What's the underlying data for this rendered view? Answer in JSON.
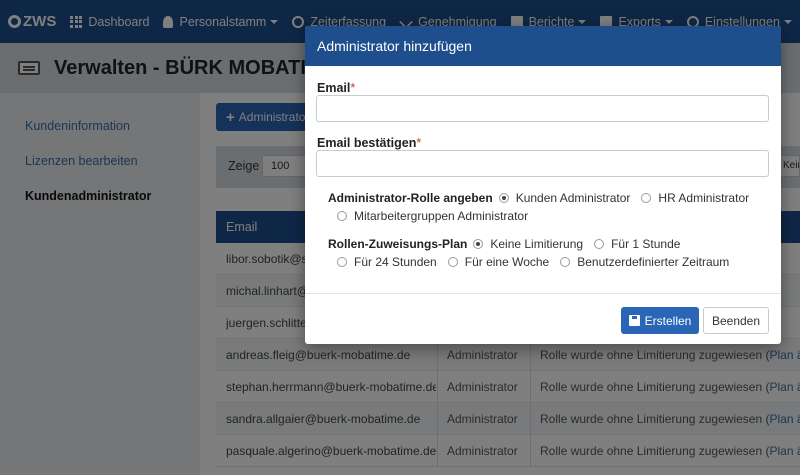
{
  "nav": {
    "logo": "ZWS",
    "items": [
      {
        "label": "Dashboard",
        "icon": "grid-icon",
        "dropdown": false
      },
      {
        "label": "Personalstamm",
        "icon": "user-icon",
        "dropdown": true
      },
      {
        "label": "Zeiterfassung",
        "icon": "clock-icon",
        "dropdown": false
      },
      {
        "label": "Genehmigung",
        "icon": "check-icon",
        "dropdown": false
      },
      {
        "label": "Berichte",
        "icon": "report-icon",
        "dropdown": true
      },
      {
        "label": "Exports",
        "icon": "export-icon",
        "dropdown": true
      },
      {
        "label": "Einstellungen",
        "icon": "gear-icon",
        "dropdown": true
      }
    ]
  },
  "header": {
    "title": "Verwalten - BÜRK MOBATIME G"
  },
  "sidebar": {
    "items": [
      {
        "label": "Kundeninformation",
        "active": false
      },
      {
        "label": "Lizenzen bearbeiten",
        "active": false
      },
      {
        "label": "Kundenadministrator",
        "active": true
      }
    ]
  },
  "main": {
    "add_button": "Administrator",
    "filter": {
      "show_label": "Zeige",
      "per_page": "100",
      "right_value": "Keine"
    },
    "table": {
      "header_email": "Email",
      "rows": [
        {
          "email": "libor.sobotik@se",
          "role": "",
          "plan": "",
          "link": ""
        },
        {
          "email": "michal.linhart@",
          "role": "",
          "plan": "",
          "link": ""
        },
        {
          "email": "juergen.schlitter",
          "role": "",
          "plan": "",
          "link": ""
        },
        {
          "email": "andreas.fleig@buerk-mobatime.de",
          "role": "Administrator",
          "plan": "Rolle wurde ohne Limitierung zugewiesen (",
          "link": "Plan ände"
        },
        {
          "email": "stephan.herrmann@buerk-mobatime.de",
          "role": "Administrator",
          "plan": "Rolle wurde ohne Limitierung zugewiesen (",
          "link": "Plan ände"
        },
        {
          "email": "sandra.allgaier@buerk-mobatime.de",
          "role": "Administrator",
          "plan": "Rolle wurde ohne Limitierung zugewiesen (",
          "link": "Plan ände"
        },
        {
          "email": "pasquale.algerino@buerk-mobatime.de",
          "role": "Administrator",
          "plan": "Rolle wurde ohne Limitierung zugewiesen (",
          "link": "Plan ände"
        }
      ]
    }
  },
  "modal": {
    "title": "Administrator hinzufügen",
    "email_label": "Email",
    "email_value": "",
    "email_confirm_label": "Email bestätigen",
    "email_confirm_value": "",
    "required_mark": "*",
    "role_group_label": "Administrator-Rolle angeben",
    "role_options": [
      {
        "label": "Kunden Administrator",
        "selected": true
      },
      {
        "label": "HR Administrator",
        "selected": false
      },
      {
        "label": "Mitarbeitergruppen Administrator",
        "selected": false
      }
    ],
    "plan_group_label": "Rollen-Zuweisungs-Plan",
    "plan_options": [
      {
        "label": "Keine Limitierung",
        "selected": true
      },
      {
        "label": "Für 1 Stunde",
        "selected": false
      },
      {
        "label": "Für 24 Stunden",
        "selected": false
      },
      {
        "label": "Für eine Woche",
        "selected": false
      },
      {
        "label": "Benutzerdefinierter Zeitraum",
        "selected": false
      }
    ],
    "create_button": "Erstellen",
    "close_button": "Beenden"
  },
  "colors": {
    "primary": "#1f4e8c",
    "button": "#2b65b5",
    "link": "#3a6ea5",
    "required": "#c0392b"
  }
}
